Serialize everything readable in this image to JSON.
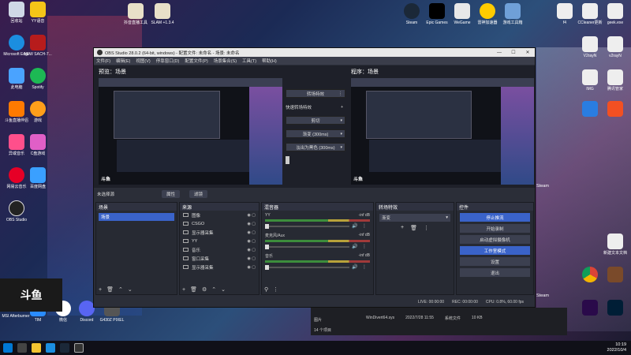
{
  "desktop": {
    "left_icons": [
      "回收站",
      "YY语音",
      "Microsoft Edge",
      "NEW SACH-7...",
      "此电脑",
      "Spotify",
      "斗鱼直播伴侣",
      "游戏",
      "异或音乐",
      "C盘游戏",
      "网易云音乐",
      "百度网盘",
      "OBS Studio"
    ],
    "bottom_icons": [
      "MSI Afterburner",
      "TIM",
      "微信",
      "Discord",
      "G430Z PIXEL"
    ],
    "top_icons": [
      "抖音直播工具",
      "SLAM +1.3.4",
      "Epic Games",
      "Steam",
      "WeGame",
      "雷神加速器",
      "游戏工具箱"
    ],
    "right_icons": [
      "f4",
      "CCleaner更新",
      "geek.exe",
      "V2rayN",
      "v2rayN",
      "IMG",
      "腾讯管家",
      "Steam",
      "Steam",
      "新建文本文档"
    ]
  },
  "obs": {
    "title": "OBS Studio 28.0.2 (64-bit, windows) - 配置文件: 未命名 - 场景: 未命名",
    "menu": [
      "文件(F)",
      "编辑(E)",
      "视图(V)",
      "停靠窗口(D)",
      "配置文件(P)",
      "场景集合(S)",
      "工具(T)",
      "帮助(H)"
    ],
    "preview_label": "预览：场景",
    "program_label": "程序：场景",
    "watermark": "斗鱼",
    "mid": {
      "transition_label": "转场特效",
      "quick_label": "快速转场特效",
      "cut": "剪切",
      "fade": "渐变 (300ms)",
      "fade_black": "淡出为黑色 (300ms)"
    },
    "no_source": "未选择源",
    "props_btn": "属性",
    "filters_btn": "滤镜",
    "docks": {
      "scenes": {
        "title": "场景",
        "items": [
          "场景"
        ]
      },
      "sources": {
        "title": "来源",
        "items": [
          "图像",
          "CSGO",
          "显示器采集",
          "YY",
          "音乐",
          "窗口采集",
          "显示器采集"
        ]
      },
      "mixer": {
        "title": "混音器",
        "channels": [
          {
            "name": "YY",
            "db": "-inf dB"
          },
          {
            "name": "麦克风/Aux",
            "db": "-inf dB"
          },
          {
            "name": "音乐",
            "db": "-inf dB"
          }
        ]
      },
      "transitions": {
        "title": "转场特效",
        "selected": "渐变"
      },
      "controls": {
        "title": "控件",
        "buttons": [
          "停止推流",
          "开始录制",
          "启动虚拟摄像机",
          "工作室模式",
          "设置",
          "退出"
        ]
      }
    },
    "status": {
      "live": "LIVE: 00:00:00",
      "rec": "REC: 00:00:00",
      "cpu": "CPU: 0.8%, 60.00 fps"
    }
  },
  "douyu": {
    "brand": "斗鱼"
  },
  "explorer": {
    "folder": "图片",
    "file": "WinDivert64.sys",
    "date": "2022/7/28 11:55",
    "type": "系统文件",
    "size": "10 KB",
    "count": "14 个项目"
  },
  "clock": {
    "time": "10:19",
    "date": "2022/10/4"
  }
}
